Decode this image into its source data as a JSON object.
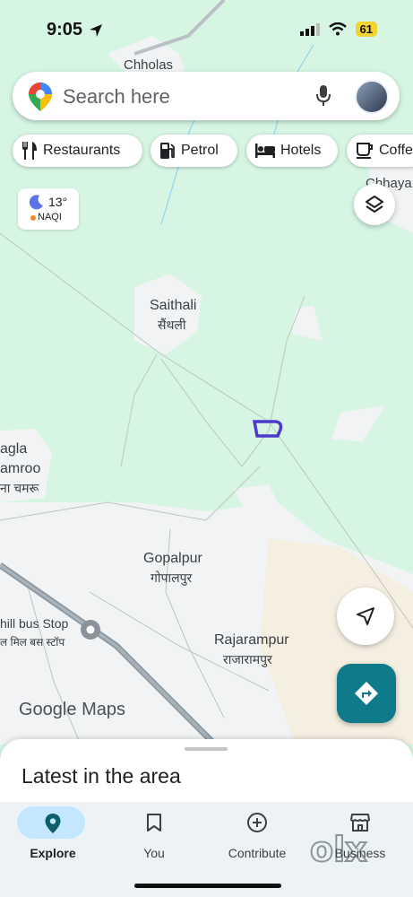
{
  "status_bar": {
    "time": "9:05",
    "battery": "61"
  },
  "search": {
    "placeholder": "Search here"
  },
  "chips": [
    {
      "label": "Restaurants",
      "icon": "fork-knife-icon"
    },
    {
      "label": "Petrol",
      "icon": "fuel-pump-icon"
    },
    {
      "label": "Hotels",
      "icon": "bed-icon"
    },
    {
      "label": "Coffe",
      "icon": "coffee-cup-icon"
    }
  ],
  "weather": {
    "temp": "13°",
    "aqi": "NAQI"
  },
  "places": {
    "chholas": "Chholas",
    "chhaya": "Chhaya",
    "saithali": "Saithali",
    "saithali_hi": "सैंथली",
    "agla": "agla",
    "amroo": "amroo",
    "amroo_hi": "ना चमरू",
    "gopalpur": "Gopalpur",
    "gopalpur_hi": "गोपालपुर",
    "bus_stop": "hill bus Stop",
    "bus_stop_hi": "ल मिल बस स्टॉप",
    "rajarampur": "Rajarampur",
    "rajarampur_hi": "राजारामपुर"
  },
  "logo": {
    "google": "Google",
    "maps": "Maps"
  },
  "sheet": {
    "title": "Latest in the area"
  },
  "nav": [
    {
      "label": "Explore",
      "icon": "location-pin-icon",
      "active": true
    },
    {
      "label": "You",
      "icon": "bookmark-icon",
      "active": false
    },
    {
      "label": "Contribute",
      "icon": "add-circle-icon",
      "active": false
    },
    {
      "label": "Business",
      "icon": "storefront-icon",
      "active": false
    }
  ],
  "watermark": "olx",
  "colors": {
    "map_green": "#d6f5e3",
    "accent": "#0f7b8a",
    "nav_active": "#c2e7ff"
  }
}
